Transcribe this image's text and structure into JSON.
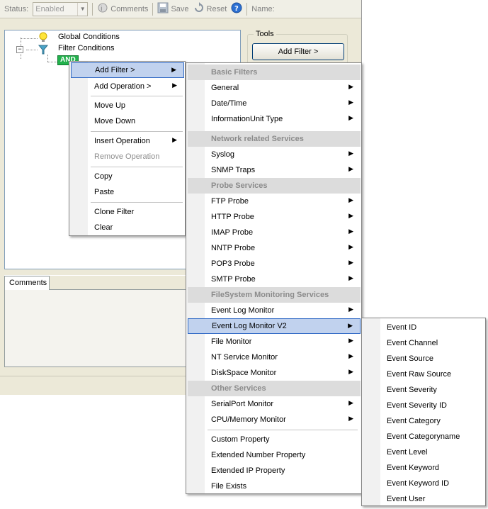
{
  "toolbar": {
    "status_label": "Status:",
    "status_value": "Enabled",
    "comments_label": "Comments",
    "save_label": "Save",
    "reset_label": "Reset",
    "name_label": "Name:"
  },
  "tree": {
    "global_conditions": "Global Conditions",
    "filter_conditions": "Filter Conditions",
    "and_node": "AND"
  },
  "tools": {
    "group_label": "Tools",
    "add_filter_button": "Add Filter >"
  },
  "comments_tab": "Comments",
  "context_menu": {
    "items": [
      "Add Filter >",
      "Add Operation >",
      "Move Up",
      "Move Down",
      "Insert Operation",
      "Remove Operation",
      "Copy",
      "Paste",
      "Clone Filter",
      "Clear"
    ]
  },
  "filter_menu": {
    "headers": [
      "Basic Filters",
      "Network related Services",
      "Probe Services",
      "FileSystem Monitoring Services",
      "Other Services"
    ],
    "items": [
      "General",
      "Date/Time",
      "InformationUnit Type",
      "Syslog",
      "SNMP Traps",
      "FTP Probe",
      "HTTP Probe",
      "IMAP Probe",
      "NNTP Probe",
      "POP3 Probe",
      "SMTP Probe",
      "Event Log Monitor",
      "Event Log Monitor V2",
      "File Monitor",
      "NT Service Monitor",
      "DiskSpace Monitor",
      "SerialPort Monitor",
      "CPU/Memory Monitor",
      "Custom Property",
      "Extended Number Property",
      "Extended IP Property",
      "File Exists"
    ]
  },
  "event_menu": {
    "items": [
      "Event ID",
      "Event Channel",
      "Event Source",
      "Event Raw Source",
      "Event Severity",
      "Event Severity ID",
      "Event Category",
      "Event Categoryname",
      "Event Level",
      "Event Keyword",
      "Event Keyword ID",
      "Event User"
    ]
  },
  "colors": {
    "highlight": "#c1d2ee",
    "highlight_border": "#316ac5",
    "and_node_bg": "#22b14c"
  }
}
